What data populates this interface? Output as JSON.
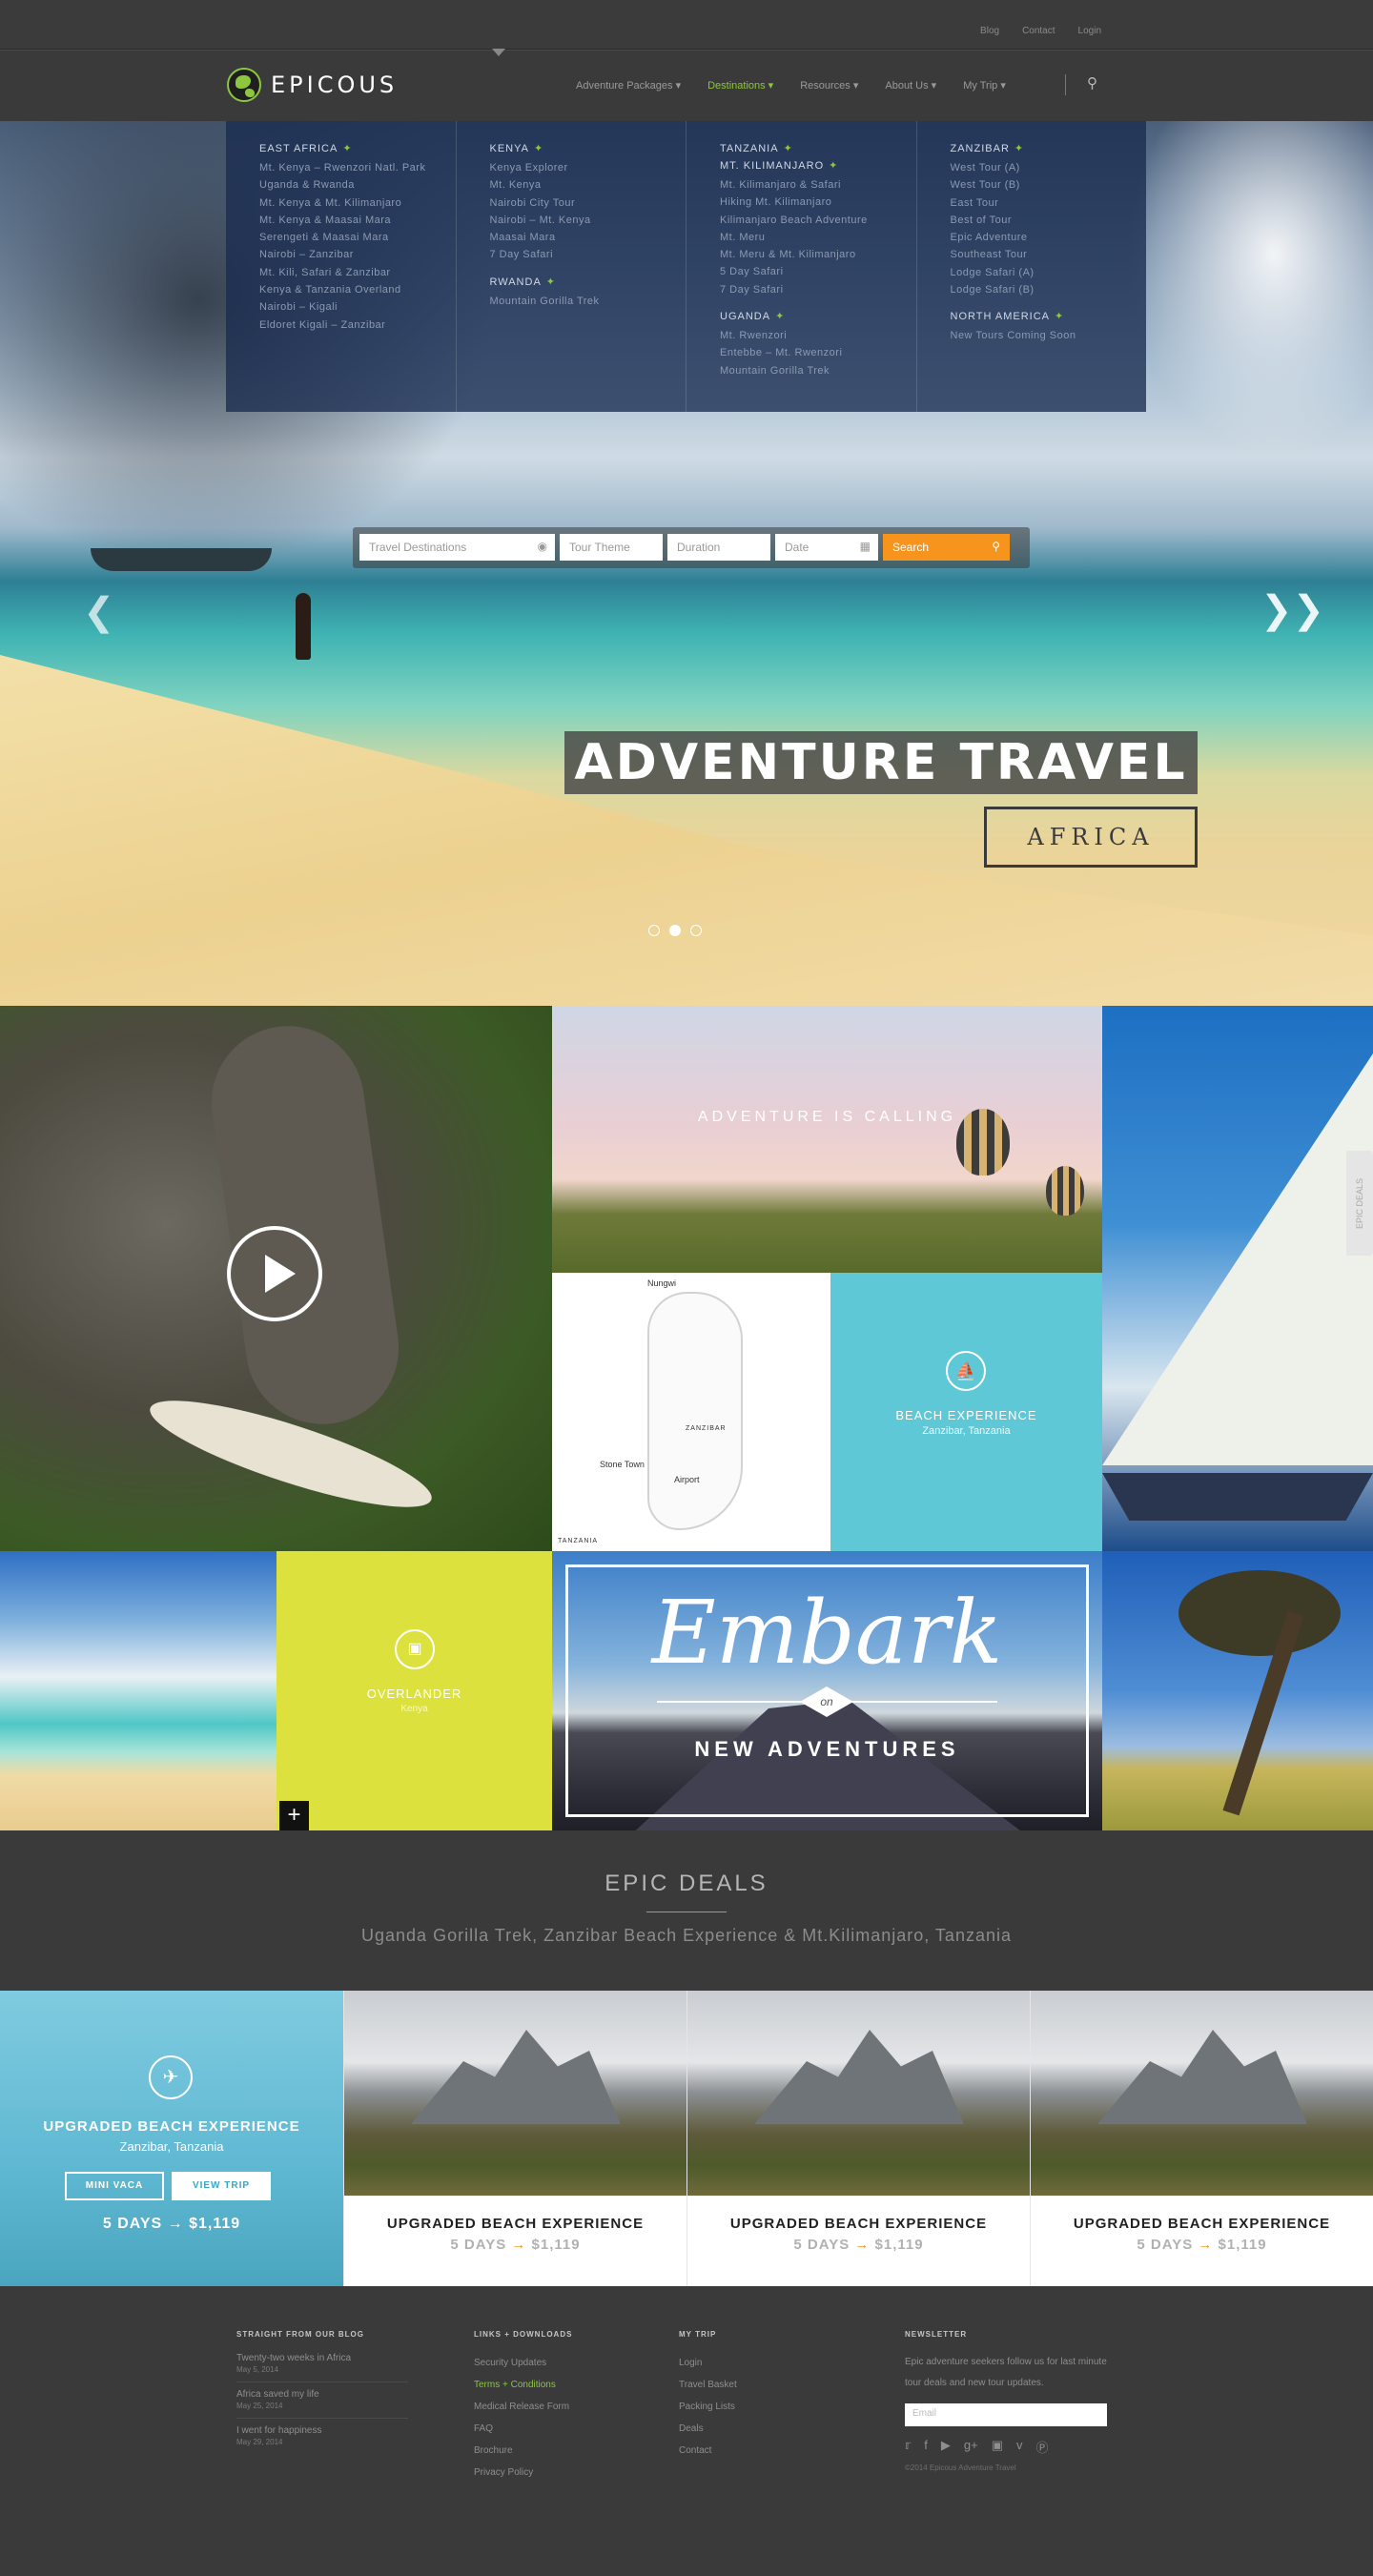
{
  "topbar": {
    "links": [
      "Blog",
      "Contact",
      "Login"
    ]
  },
  "nav": {
    "logo": "EPICOUS",
    "menu": [
      "Adventure Packages ▾",
      "Destinations ▾",
      "Resources ▾",
      "About Us ▾",
      "My Trip ▾"
    ],
    "active_index": 1,
    "search_icon": "search-icon"
  },
  "dropdown": [
    {
      "groups": [
        {
          "title": "EAST AFRICA",
          "items": [
            "Mt. Kenya – Rwenzori Natl. Park",
            "Uganda & Rwanda",
            "Mt. Kenya & Mt. Kilimanjaro",
            "Mt. Kenya & Maasai Mara",
            "Serengeti & Maasai Mara",
            "Nairobi – Zanzibar",
            "Mt. Kili, Safari & Zanzibar",
            "Kenya & Tanzania Overland",
            "Nairobi – Kigali",
            "Eldoret Kigali – Zanzibar"
          ]
        }
      ]
    },
    {
      "groups": [
        {
          "title": "KENYA",
          "items": [
            "Kenya Explorer",
            "Mt. Kenya",
            "Nairobi City Tour",
            "Nairobi – Mt. Kenya",
            "Maasai Mara",
            "7 Day Safari"
          ]
        },
        {
          "title": "RWANDA",
          "items": [
            "Mountain Gorilla Trek"
          ]
        }
      ]
    },
    {
      "groups": [
        {
          "title": "TANZANIA",
          "items": []
        },
        {
          "title": "MT. KILIMANJARO",
          "items": [
            "Mt. Kilimanjaro & Safari",
            "Hiking Mt. Kilimanjaro",
            "Kilimanjaro Beach Adventure",
            "Mt. Meru",
            "Mt. Meru & Mt. Kilimanjaro",
            "5 Day Safari",
            "7 Day Safari"
          ]
        },
        {
          "title": "UGANDA",
          "items": [
            "Mt. Rwenzori",
            "Entebbe – Mt. Rwenzori",
            "Mountain Gorilla Trek"
          ]
        }
      ]
    },
    {
      "groups": [
        {
          "title": "ZANZIBAR",
          "items": [
            "West Tour (A)",
            "West Tour (B)",
            "East Tour",
            "Best of Tour",
            "Epic Adventure",
            "Southeast Tour",
            "Lodge Safari (A)",
            "Lodge Safari (B)"
          ]
        },
        {
          "title": "NORTH AMERICA",
          "items": [
            "New Tours Coming Soon"
          ]
        }
      ]
    }
  ],
  "search": {
    "destinations": "Travel Destinations",
    "theme": "Tour Theme",
    "duration": "Duration",
    "date": "Date",
    "button": "Search"
  },
  "hero": {
    "headline": "ADVENTURE TRAVEL",
    "sub": "AFRICA",
    "slides": 3,
    "active_slide": 1
  },
  "tiles": {
    "calling": "ADVENTURE IS CALLING",
    "map": {
      "nungwi": "Nungwi",
      "zanzibar": "ZANZIBAR",
      "stone_town": "Stone Town",
      "airport": "Airport",
      "tanzania": "TANZANIA"
    },
    "beach": {
      "title": "BEACH EXPERIENCE",
      "sub": "Zanzibar, Tanzania"
    },
    "overlander": {
      "title": "OVERLANDER",
      "sub": "Kenya"
    },
    "embark": {
      "script": "Embark",
      "on": "on",
      "sub": "NEW ADVENTURES"
    },
    "side_tab": "EPIC DEALS"
  },
  "epic": {
    "title": "EPIC DEALS",
    "sub": "Uganda Gorilla Trek, Zanzibar Beach Experience & Mt.Kilimanjaro, Tanzania"
  },
  "featured": {
    "title": "UPGRADED BEACH EXPERIENCE",
    "location": "Zanzibar, Tanzania",
    "btn1": "MINI VACA",
    "btn2": "VIEW TRIP",
    "days": "5 DAYS",
    "price": "$1,119"
  },
  "cards": [
    {
      "title": "UPGRADED BEACH EXPERIENCE",
      "days": "5 DAYS",
      "price": "$1,119"
    },
    {
      "title": "UPGRADED BEACH EXPERIENCE",
      "days": "5 DAYS",
      "price": "$1,119"
    },
    {
      "title": "UPGRADED BEACH EXPERIENCE",
      "days": "5 DAYS",
      "price": "$1,119"
    }
  ],
  "footer": {
    "blog": {
      "title": "STRAIGHT FROM OUR BLOG",
      "posts": [
        {
          "t": "Twenty-two weeks in Africa",
          "d": "May 5, 2014"
        },
        {
          "t": "Africa saved my life",
          "d": "May 25, 2014"
        },
        {
          "t": "I went for happiness",
          "d": "May 29, 2014"
        }
      ]
    },
    "links": {
      "title": "LINKS + DOWNLOADS",
      "items": [
        "Security Updates",
        "Terms + Conditions",
        "Medical Release Form",
        "FAQ",
        "Brochure",
        "Privacy Policy"
      ]
    },
    "trip": {
      "title": "MY TRIP",
      "items": [
        "Login",
        "Travel Basket",
        "Packing Lists",
        "Deals",
        "Contact"
      ]
    },
    "newsletter": {
      "title": "NEWSLETTER",
      "text": "Epic adventure seekers follow us for last minute tour deals and new tour updates.",
      "placeholder": "Email",
      "copy": "©2014 Epicous Adventure Travel"
    }
  },
  "colors": {
    "accent": "#8dc63f",
    "orange": "#f7941d",
    "dark": "#3a3a3a"
  }
}
